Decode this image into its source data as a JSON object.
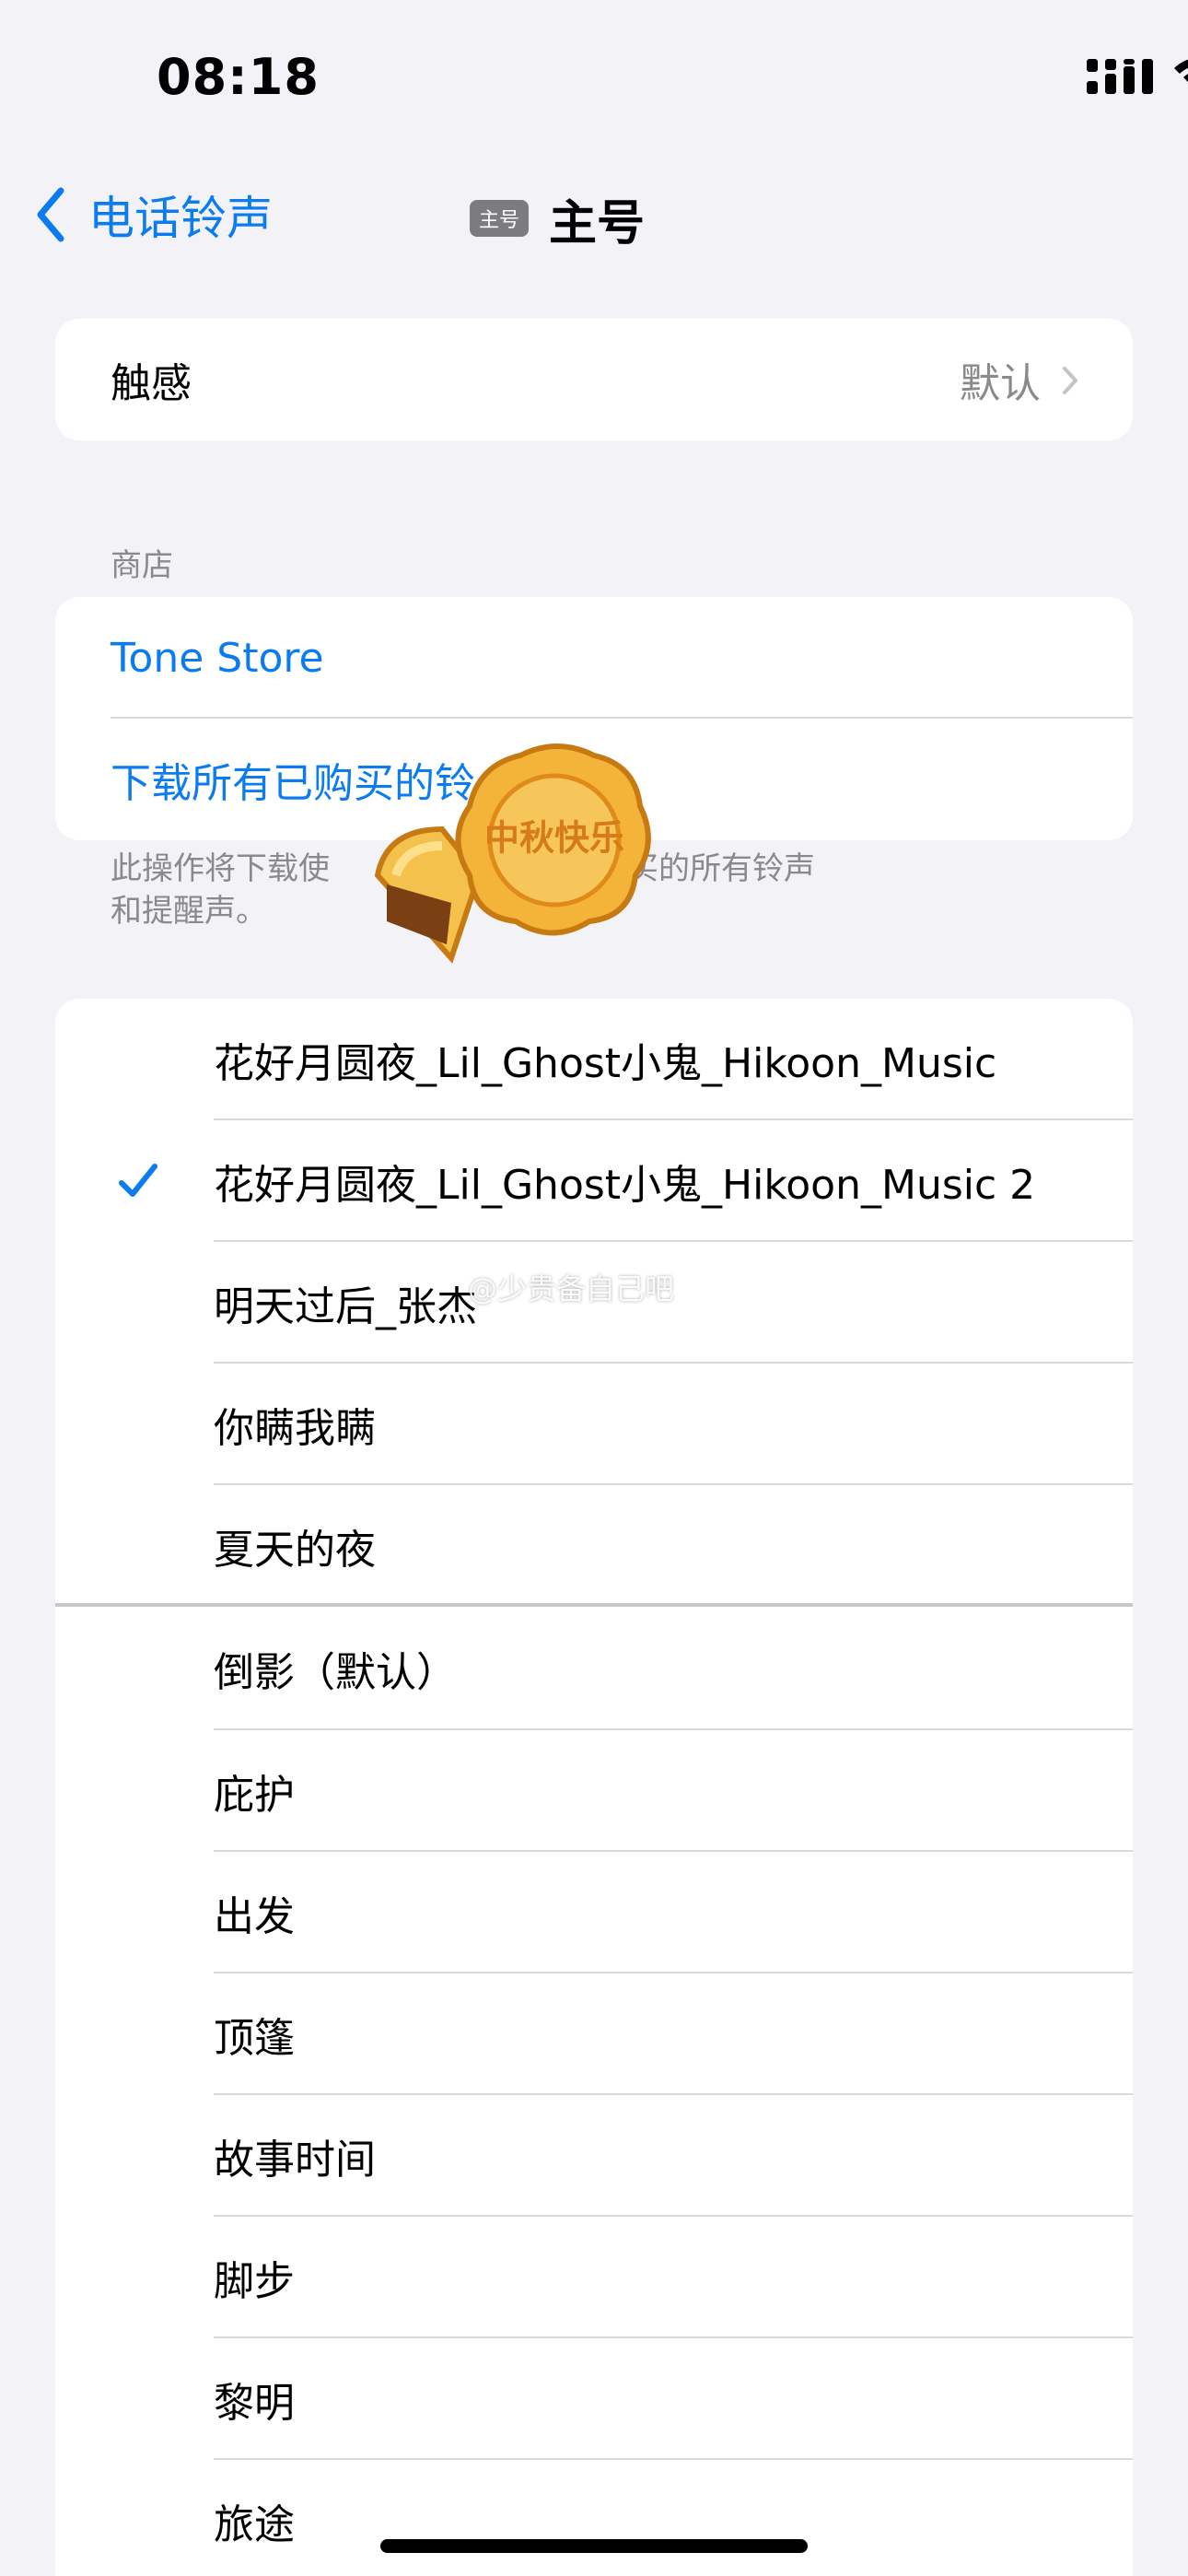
{
  "status_bar": {
    "time": "08:18"
  },
  "nav": {
    "back_label": "电话铃声",
    "line_badge": "主号",
    "title": "主号"
  },
  "haptics": {
    "label": "触感",
    "value": "默认"
  },
  "store": {
    "header": "商店",
    "tone_store": "Tone Store",
    "download_all": "下载所有已购买的铃",
    "footer_line1": "此操作将下载使",
    "footer_line1_tail": "户购买的所有铃声",
    "footer_line2": "和提醒声。"
  },
  "custom_tones": [
    {
      "label": "花好月圆夜_Lil_Ghost小鬼_Hikoon_Music",
      "selected": false
    },
    {
      "label": "花好月圆夜_Lil_Ghost小鬼_Hikoon_Music 2",
      "selected": true
    },
    {
      "label": "明天过后_张杰",
      "selected": false
    },
    {
      "label": "你瞒我瞒",
      "selected": false
    },
    {
      "label": "夏天的夜",
      "selected": false
    }
  ],
  "system_tones": [
    {
      "label": "倒影（默认）"
    },
    {
      "label": "庇护"
    },
    {
      "label": "出发"
    },
    {
      "label": "顶篷"
    },
    {
      "label": "故事时间"
    },
    {
      "label": "脚步"
    },
    {
      "label": "黎明"
    },
    {
      "label": "旅途"
    }
  ],
  "sticker": {
    "text": "中秋快乐"
  },
  "watermark": "@少贵备自己吧",
  "colors": {
    "accent": "#0a7cf0",
    "background": "#f2f2f7",
    "secondary_text": "#8a8a8e"
  },
  "icons": [
    "cellular-signal-icon",
    "wifi-icon",
    "battery-icon",
    "back-chevron-icon",
    "chevron-right-icon",
    "checkmark-icon"
  ]
}
